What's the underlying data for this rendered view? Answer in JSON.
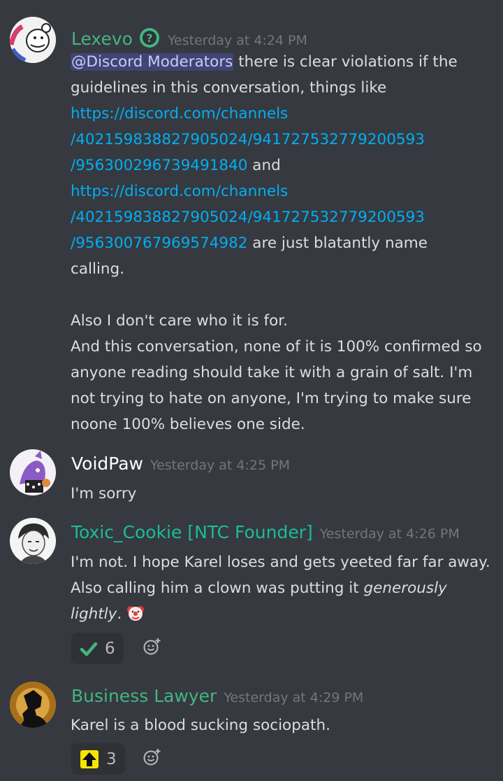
{
  "messages": [
    {
      "username": "Lexevo",
      "username_color": "#43b581",
      "badge": "question-badge-icon",
      "timestamp": "Yesterday at 4:24 PM",
      "lines": [
        [
          "@Discord Moderators",
          " there is clear violations if the"
        ],
        [
          "guidelines in this conversation, things like"
        ],
        [
          "https://discord.com/channels"
        ],
        [
          "/402159838827905024/941727532779200593"
        ],
        [
          "/956300296739491840",
          " and"
        ],
        [
          "https://discord.com/channels"
        ],
        [
          "/402159838827905024/941727532779200593"
        ],
        [
          "/956300767969574982",
          " are just blatantly name"
        ],
        [
          "calling."
        ],
        [
          ""
        ],
        [
          "Also I don't care who it is for."
        ],
        [
          "And this conversation, none of it is 100% confirmed so"
        ],
        [
          "anyone reading should take it with a grain of salt. I'm"
        ],
        [
          "not trying to hate on anyone, I'm trying to make sure"
        ],
        [
          "noone 100% believes one side."
        ]
      ]
    },
    {
      "username": "VoidPaw",
      "username_color": "#ffffff",
      "timestamp": "Yesterday at 4:25 PM",
      "lines": [
        [
          "I'm sorry"
        ]
      ]
    },
    {
      "username": "Toxic_Cookie [NTC Founder]",
      "username_color": "#1abc9c",
      "timestamp": "Yesterday at 4:26 PM",
      "lines": [
        [
          "I'm not. I hope Karel loses and gets yeeted far far away."
        ],
        [
          "Also calling him a clown was putting it ",
          "generously"
        ],
        [
          "lightly",
          ". "
        ]
      ],
      "inline_emoji": "clown-emoji",
      "reaction": {
        "emoji": "check-mark-emoji",
        "count": "6"
      }
    },
    {
      "username": "Business Lawyer",
      "username_color": "#43b581",
      "timestamp": "Yesterday at 4:29 PM",
      "lines": [
        [
          "Karel is a blood sucking sociopath."
        ]
      ],
      "reaction": {
        "emoji": "up-arrow-emoji",
        "count": "3"
      }
    }
  ]
}
